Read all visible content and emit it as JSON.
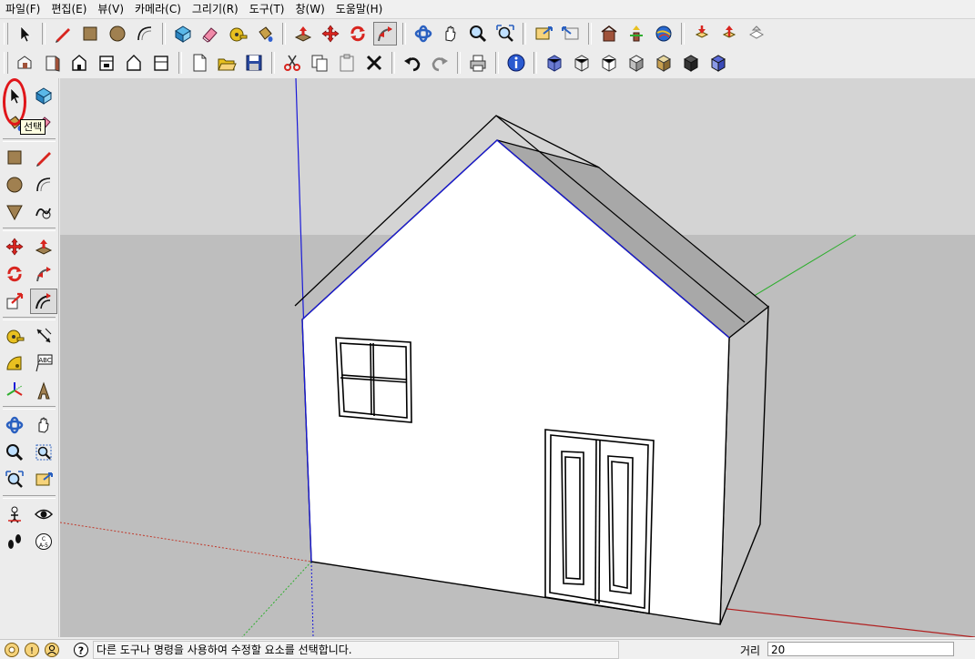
{
  "menu": [
    "파일(F)",
    "편집(E)",
    "뷰(V)",
    "카메라(C)",
    "그리기(R)",
    "도구(T)",
    "창(W)",
    "도움말(H)"
  ],
  "toolbar_top": [
    {
      "name": "select-tool-icon"
    },
    {
      "sep": true
    },
    {
      "name": "pencil-line-icon"
    },
    {
      "name": "rectangle-icon"
    },
    {
      "name": "circle-icon"
    },
    {
      "name": "arc-icon"
    },
    {
      "sep": true
    },
    {
      "name": "make-component-icon"
    },
    {
      "name": "eraser-icon"
    },
    {
      "name": "tape-measure-icon"
    },
    {
      "name": "paint-bucket-icon"
    },
    {
      "sep": true
    },
    {
      "name": "push-pull-icon"
    },
    {
      "name": "move-icon"
    },
    {
      "name": "rotate-icon"
    },
    {
      "name": "follow-me-icon",
      "pressed": true
    },
    {
      "sep": true
    },
    {
      "name": "orbit-icon"
    },
    {
      "name": "pan-icon"
    },
    {
      "name": "zoom-icon"
    },
    {
      "name": "zoom-extents-icon"
    },
    {
      "sep": true
    },
    {
      "name": "previous-view-icon"
    },
    {
      "name": "next-view-icon"
    },
    {
      "sep": true
    },
    {
      "name": "warehouse-icon"
    },
    {
      "name": "share-model-icon"
    },
    {
      "name": "google-earth-icon"
    },
    {
      "sep": true
    },
    {
      "name": "get-models-icon"
    },
    {
      "name": "share-component-icon"
    },
    {
      "name": "preview-icon"
    }
  ],
  "toolbar_views": [
    {
      "name": "iso-view-icon"
    },
    {
      "name": "top-view-icon"
    },
    {
      "name": "front-view-icon"
    },
    {
      "name": "right-view-icon"
    },
    {
      "name": "back-view-icon"
    },
    {
      "name": "left-view-icon"
    },
    {
      "sep": true
    },
    {
      "name": "new-file-icon"
    },
    {
      "name": "open-file-icon"
    },
    {
      "name": "save-file-icon"
    },
    {
      "sep": true
    },
    {
      "name": "cut-icon"
    },
    {
      "name": "copy-icon"
    },
    {
      "name": "paste-icon"
    },
    {
      "name": "delete-icon"
    },
    {
      "sep": true
    },
    {
      "name": "undo-icon"
    },
    {
      "name": "redo-icon"
    },
    {
      "sep": true
    },
    {
      "name": "print-icon"
    },
    {
      "sep": true
    },
    {
      "name": "model-info-icon"
    },
    {
      "sep": true
    },
    {
      "name": "xray-icon"
    },
    {
      "name": "wireframe-icon"
    },
    {
      "name": "hidden-line-icon"
    },
    {
      "name": "shaded-icon"
    },
    {
      "name": "shaded-texture-icon"
    },
    {
      "name": "monochrome-icon"
    },
    {
      "name": "back-edges-icon"
    }
  ],
  "left_tools": [
    {
      "name": "select-tool-icon"
    },
    {
      "name": "make-component-icon"
    },
    {
      "name": "paint-bucket-icon"
    },
    {
      "name": "eraser-icon"
    },
    {
      "sep": true
    },
    {
      "name": "rectangle-icon"
    },
    {
      "name": "pencil-line-icon"
    },
    {
      "name": "circle-icon"
    },
    {
      "name": "arc-icon"
    },
    {
      "name": "polygon-icon"
    },
    {
      "name": "freehand-icon"
    },
    {
      "sep": true
    },
    {
      "name": "move-icon"
    },
    {
      "name": "push-pull-icon"
    },
    {
      "name": "rotate-icon"
    },
    {
      "name": "follow-me-icon"
    },
    {
      "name": "scale-icon"
    },
    {
      "name": "offset-icon",
      "pressed": true
    },
    {
      "sep": true
    },
    {
      "name": "tape-measure-icon"
    },
    {
      "name": "dimension-icon"
    },
    {
      "name": "protractor-icon"
    },
    {
      "name": "text-label-icon"
    },
    {
      "name": "axes-icon"
    },
    {
      "name": "3d-text-icon"
    },
    {
      "sep": true
    },
    {
      "name": "orbit-icon"
    },
    {
      "name": "pan-icon"
    },
    {
      "name": "zoom-icon"
    },
    {
      "name": "zoom-window-icon"
    },
    {
      "name": "zoom-extents-icon"
    },
    {
      "name": "previous-view-icon"
    },
    {
      "sep": true
    },
    {
      "name": "position-camera-icon"
    },
    {
      "name": "look-around-icon"
    },
    {
      "name": "walk-icon"
    },
    {
      "name": "section-plane-icon"
    }
  ],
  "tooltip": "선택",
  "status": {
    "message": "다른 도구나 명령을 사용하여 수정할 요소를 선택합니다.",
    "vcb_label": "거리",
    "vcb_value": "20"
  },
  "colors": {
    "axis_red": "#c0392b",
    "axis_green": "#2eae2e",
    "axis_blue": "#1a1ad8",
    "sky": "#d3d3d3",
    "ground": "#bdbdbd",
    "wall_front": "#ffffff",
    "wall_side": "#c4c4c4",
    "roof_side": "#a8a8a8",
    "highlight": "#e0151a"
  }
}
